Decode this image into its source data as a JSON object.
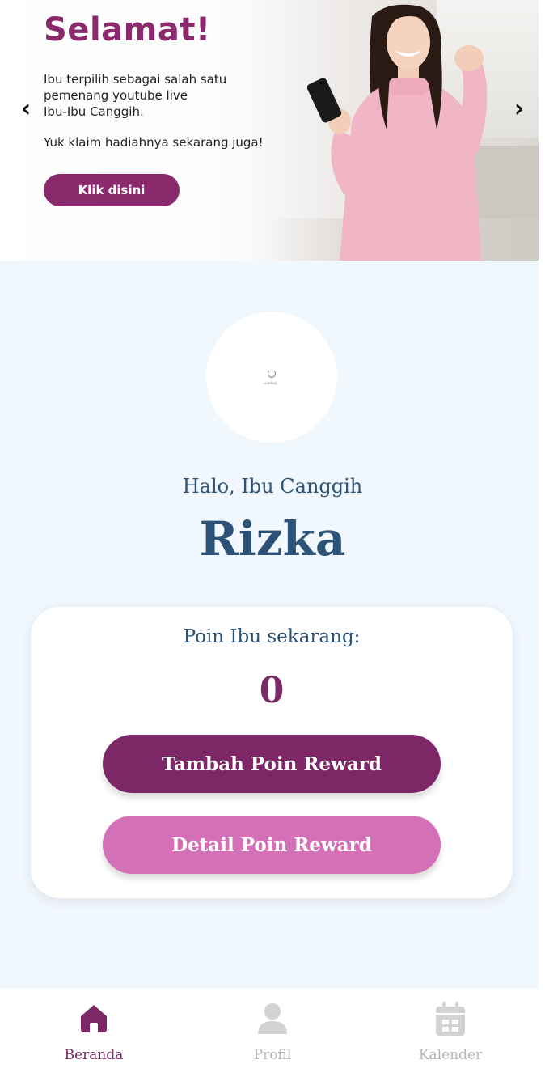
{
  "banner": {
    "title": "Selamat!",
    "line1": "Ibu terpilih sebagai salah satu",
    "line2": "pemenang youtube live",
    "line3": "Ibu-Ibu Canggih.",
    "line4": "Yuk klaim hadiahnya sekarang juga!",
    "cta_label": "Klik disini",
    "prev_arrow": "‹",
    "next_arrow": "›"
  },
  "profile": {
    "loading_text": "Loading...",
    "greeting": "Halo, Ibu Canggih",
    "name": "Rizka"
  },
  "points_card": {
    "label": "Poin Ibu sekarang:",
    "points": "0",
    "add_button": "Tambah Poin Reward",
    "detail_button": "Detail Poin Reward"
  },
  "bottom_nav": {
    "items": [
      {
        "label": "Beranda",
        "icon": "home-icon",
        "active": true
      },
      {
        "label": "Profil",
        "icon": "user-icon",
        "active": false
      },
      {
        "label": "Kalender",
        "icon": "calendar-icon",
        "active": false
      }
    ]
  },
  "colors": {
    "brand_purple": "#7e2767",
    "pink": "#d470b7",
    "navy": "#2c5278",
    "background": "#f0f7fd",
    "inactive": "#b5b5b5"
  }
}
